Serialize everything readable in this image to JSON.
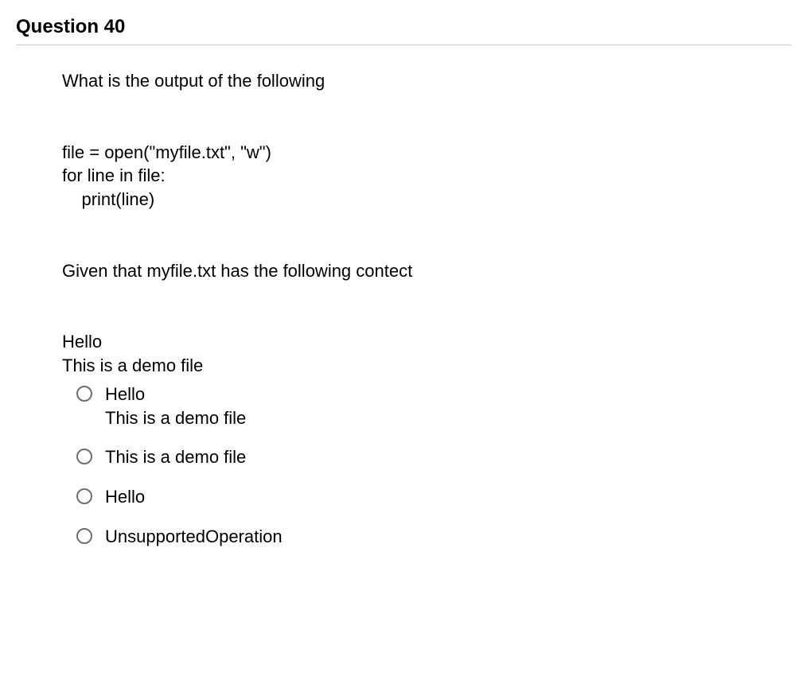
{
  "question": {
    "heading": "Question 40",
    "prompt": "What is the output of the following",
    "code": "file = open(\"myfile.txt\", \"w\")\nfor line in file:\n    print(line)",
    "given": "Given that myfile.txt has the following contect",
    "file_content": "Hello\nThis is a demo file",
    "options": [
      {
        "label": "Hello\nThis is a demo file"
      },
      {
        "label": "This is a demo file"
      },
      {
        "label": "Hello"
      },
      {
        "label": "UnsupportedOperation"
      }
    ]
  }
}
